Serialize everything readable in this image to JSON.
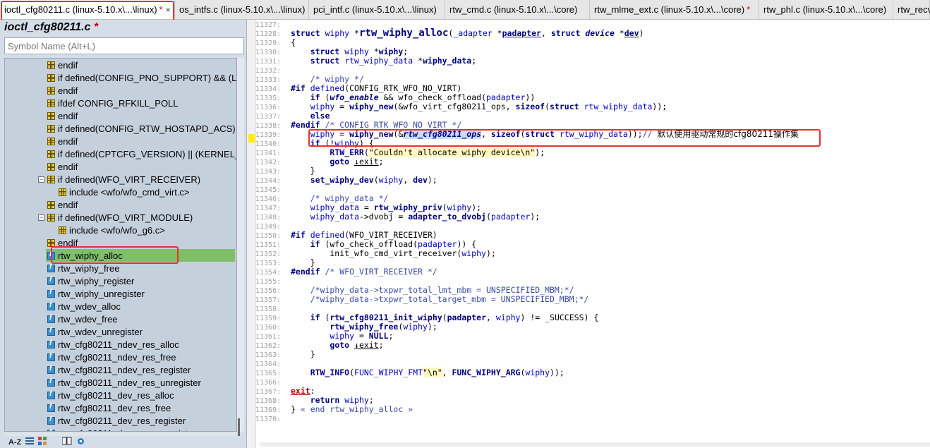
{
  "tabs": [
    {
      "label": "ioctl_cfg80211.c (linux-5.10.x\\...\\linux)",
      "modified": true,
      "active": true
    },
    {
      "label": "os_intfs.c (linux-5.10.x\\...\\linux)",
      "modified": false,
      "active": false
    },
    {
      "label": "pci_intf.c (linux-5.10.x\\...\\linux)",
      "modified": false,
      "active": false
    },
    {
      "label": "rtw_cmd.c (linux-5.10.x\\...\\core)",
      "modified": false,
      "active": false
    },
    {
      "label": "rtw_mlme_ext.c (linux-5.10.x\\...\\core)",
      "modified": true,
      "active": false
    },
    {
      "label": "rtw_phl.c (linux-5.10.x\\...\\core)",
      "modified": false,
      "active": false
    },
    {
      "label": "rtw_recv",
      "modified": false,
      "active": false
    }
  ],
  "tab_star": "*",
  "tab_close": "×",
  "symbol_panel": {
    "title": "ioctl_cfg80211.c",
    "title_star": "*",
    "search_placeholder": "Symbol Name (Alt+L)",
    "items": [
      {
        "label": "endif",
        "type": "pp",
        "indent": 1,
        "expander": ""
      },
      {
        "label": "if defined(CONFIG_PNO_SUPPORT) && (LI",
        "type": "pp",
        "indent": 1,
        "expander": ""
      },
      {
        "label": "endif",
        "type": "pp",
        "indent": 1,
        "expander": ""
      },
      {
        "label": "ifdef CONFIG_RFKILL_POLL",
        "type": "pp",
        "indent": 1,
        "expander": ""
      },
      {
        "label": "endif",
        "type": "pp",
        "indent": 1,
        "expander": ""
      },
      {
        "label": "if defined(CONFIG_RTW_HOSTAPD_ACS) &",
        "type": "pp",
        "indent": 1,
        "expander": ""
      },
      {
        "label": "endif",
        "type": "pp",
        "indent": 1,
        "expander": ""
      },
      {
        "label": "if defined(CPTCFG_VERSION) || (KERNEL_VI",
        "type": "pp",
        "indent": 1,
        "expander": ""
      },
      {
        "label": "endif",
        "type": "pp",
        "indent": 1,
        "expander": ""
      },
      {
        "label": "if defined(WFO_VIRT_RECEIVER)",
        "type": "pp",
        "indent": 1,
        "expander": "−"
      },
      {
        "label": "include <wfo/wfo_cmd_virt.c>",
        "type": "pp",
        "indent": 2,
        "expander": ""
      },
      {
        "label": "endif",
        "type": "pp",
        "indent": 1,
        "expander": ""
      },
      {
        "label": "if defined(WFO_VIRT_MODULE)",
        "type": "pp",
        "indent": 1,
        "expander": "−"
      },
      {
        "label": "include <wfo/wfo_g6.c>",
        "type": "pp",
        "indent": 2,
        "expander": ""
      },
      {
        "label": "endif",
        "type": "pp",
        "indent": 1,
        "expander": ""
      },
      {
        "label": "rtw_wiphy_alloc",
        "type": "func",
        "indent": 1,
        "expander": "",
        "selected": true
      },
      {
        "label": "rtw_wiphy_free",
        "type": "func",
        "indent": 1,
        "expander": ""
      },
      {
        "label": "rtw_wiphy_register",
        "type": "func",
        "indent": 1,
        "expander": ""
      },
      {
        "label": "rtw_wiphy_unregister",
        "type": "func",
        "indent": 1,
        "expander": ""
      },
      {
        "label": "rtw_wdev_alloc",
        "type": "func",
        "indent": 1,
        "expander": ""
      },
      {
        "label": "rtw_wdev_free",
        "type": "func",
        "indent": 1,
        "expander": ""
      },
      {
        "label": "rtw_wdev_unregister",
        "type": "func",
        "indent": 1,
        "expander": ""
      },
      {
        "label": "rtw_cfg80211_ndev_res_alloc",
        "type": "func",
        "indent": 1,
        "expander": ""
      },
      {
        "label": "rtw_cfg80211_ndev_res_free",
        "type": "func",
        "indent": 1,
        "expander": ""
      },
      {
        "label": "rtw_cfg80211_ndev_res_register",
        "type": "func",
        "indent": 1,
        "expander": ""
      },
      {
        "label": "rtw_cfg80211_ndev_res_unregister",
        "type": "func",
        "indent": 1,
        "expander": ""
      },
      {
        "label": "rtw_cfg80211_dev_res_alloc",
        "type": "func",
        "indent": 1,
        "expander": ""
      },
      {
        "label": "rtw_cfg80211_dev_res_free",
        "type": "func",
        "indent": 1,
        "expander": ""
      },
      {
        "label": "rtw_cfg80211_dev_res_register",
        "type": "func",
        "indent": 1,
        "expander": ""
      },
      {
        "label": "rtw_cfg80211_dev_res_unregister",
        "type": "func",
        "indent": 1,
        "expander": ""
      }
    ],
    "bottom_buttons": [
      "A-Z",
      "list-icon",
      "symbols-icon",
      "book-icon",
      "gear-icon"
    ],
    "az_label": "A-Z"
  },
  "code_lines": [
    {
      "n": "11327:",
      "html": ""
    },
    {
      "n": "11328:",
      "html": "<span class='kw'>struct</span> <span class='id'>wiphy</span> *<span class='big'>rtw_wiphy_alloc</span>(<span class='id'>_adapter</span> *<span class='fn u'>padapter</span>, <span class='kw'>struct</span> <i class='kw'>device</i> *<span class='fn u'>dev</span>)"
    },
    {
      "n": "11329:",
      "html": "{"
    },
    {
      "n": "11330:",
      "html": "    <span class='kw'>struct</span> <span class='id'>wiphy</span> *<span class='fn'>wiphy</span>;"
    },
    {
      "n": "11331:",
      "html": "    <span class='kw'>struct</span> <span class='id'>rtw_wiphy_data</span> *<span class='fn'>wiphy_data</span>;"
    },
    {
      "n": "11332:",
      "html": ""
    },
    {
      "n": "11333:",
      "html": "    <span class='cmt'>/* wiphy */</span>"
    },
    {
      "n": "11334:",
      "html": "<span class='pp'>#if</span> <span class='id'>defined</span>(CONFIG_RTK_WFO_NO_VIRT)"
    },
    {
      "n": "11335:",
      "html": "    <span class='kw'>if</span> (<i class='fn'>wfo_enable</i> &amp;&amp; wfo_check_offload(<span class='id'>padapter</span>))"
    },
    {
      "n": "11336:",
      "html": "    <span class='id'>wiphy</span> = <span class='fn'>wiphy_new</span>(&amp;wfo_virt_cfg80211_ops, <span class='kw'>sizeof</span>(<span class='kw'>struct</span> <span class='id'>rtw_wiphy_data</span>));"
    },
    {
      "n": "11337:",
      "html": "    <span class='kw'>else</span>"
    },
    {
      "n": "11338:",
      "html": "<span class='pp'>#endif</span> <span class='cmt'>/* CONFIG_RTK_WFO_NO_VIRT */</span>"
    },
    {
      "n": "11339:",
      "html": "    <span class='id'>wiphy</span> = <span class='fn'>wiphy_new</span>(&amp;<span class='hl'>rtw_cfg80211_ops</span>, <span class='kw'>sizeof</span>(<span class='kw'>struct</span> <span class='id'>rtw_wiphy_data</span>));<span class='cmt'>// </span><span class='zh'>默认使用驱动常规的cfg80211操作集</span>"
    },
    {
      "n": "11340:",
      "html": "    <span class='kw'>if</span> (!<span class='id'>wiphy</span>) {"
    },
    {
      "n": "11341:",
      "html": "        <span class='fn'>RTW_ERR</span>(<span class='str'>\"Couldn't allocate wiphy device\\n\"</span>);"
    },
    {
      "n": "11342:",
      "html": "        <span class='kw'>goto</span> <span class='u'>↓exit</span>;"
    },
    {
      "n": "11343:",
      "html": "    }"
    },
    {
      "n": "11344:",
      "html": "    <span class='fn'>set_wiphy_dev</span>(<span class='id'>wiphy</span>, <span class='fn'>dev</span>);"
    },
    {
      "n": "11345:",
      "html": ""
    },
    {
      "n": "11346:",
      "html": "    <span class='cmt'>/* wiphy_data */</span>"
    },
    {
      "n": "11347:",
      "html": "    <span class='id'>wiphy_data</span> = <span class='fn'>rtw_wiphy_priv</span>(<span class='id'>wiphy</span>);"
    },
    {
      "n": "11348:",
      "html": "    <span class='id'>wiphy_data</span>-&gt;dvobj = <span class='fn'>adapter_to_dvobj</span>(<span class='id'>padapter</span>);"
    },
    {
      "n": "11349:",
      "html": ""
    },
    {
      "n": "11350:",
      "html": "<span class='pp'>#if</span> <span class='id'>defined</span>(WFO_VIRT_RECEIVER)"
    },
    {
      "n": "11351:",
      "html": "    <span class='kw'>if</span> (wfo_check_offload(<span class='id'>padapter</span>)) {"
    },
    {
      "n": "11352:",
      "html": "        init_wfo_cmd_virt_receiver(<span class='id'>wiphy</span>);"
    },
    {
      "n": "11353:",
      "html": "    }"
    },
    {
      "n": "11354:",
      "html": "<span class='pp'>#endif</span> <span class='cmt'>/* WFO_VIRT_RECEIVER */</span>"
    },
    {
      "n": "11355:",
      "html": ""
    },
    {
      "n": "11356:",
      "html": "    <span class='cmt'>/*wiphy_data-&gt;txpwr_total_lmt_mbm = UNSPECIFIED_MBM;*/</span>"
    },
    {
      "n": "11357:",
      "html": "    <span class='cmt'>/*wiphy_data-&gt;txpwr_total_target_mbm = UNSPECIFIED_MBM;*/</span>"
    },
    {
      "n": "11358:",
      "html": ""
    },
    {
      "n": "11359:",
      "html": "    <span class='kw'>if</span> (<span class='fn'>rtw_cfg80211_init_wiphy</span>(<span class='fn'>padapter</span>, <span class='id'>wiphy</span>) != _SUCCESS) {"
    },
    {
      "n": "11360:",
      "html": "        <span class='fn'>rtw_wiphy_free</span>(<span class='id'>wiphy</span>);"
    },
    {
      "n": "11361:",
      "html": "        <span class='id'>wiphy</span> = <span class='fn'>NULL</span>;"
    },
    {
      "n": "11362:",
      "html": "        <span class='kw'>goto</span> <span class='u'>↓exit</span>;"
    },
    {
      "n": "11363:",
      "html": "    }"
    },
    {
      "n": "11364:",
      "html": ""
    },
    {
      "n": "11365:",
      "html": "    <span class='fn'>RTW_INFO</span>(<span class='id'>FUNC_WIPHY_FMT</span><span class='str'>\"\\n\"</span>, <span class='fn'>FUNC_WIPHY_ARG</span>(<span class='id'>wiphy</span>));"
    },
    {
      "n": "11366:",
      "html": ""
    },
    {
      "n": "11367:",
      "html": "<span class='lbl'>exit</span>:"
    },
    {
      "n": "11368:",
      "html": "    <span class='kw'>return</span> <span class='id'>wiphy</span>;"
    },
    {
      "n": "11369:",
      "html": "} <span class='cmt'>« end rtw_wiphy_alloc »</span>"
    },
    {
      "n": "11370:",
      "html": ""
    }
  ]
}
